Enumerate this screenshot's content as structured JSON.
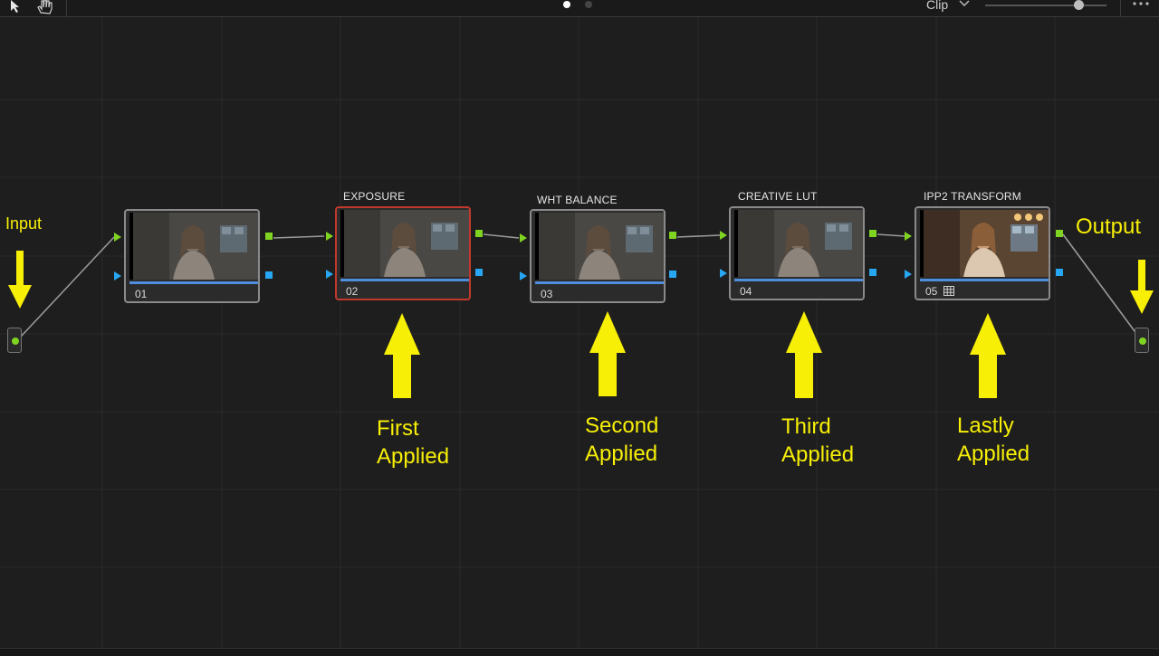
{
  "toolbar": {
    "pointer_icon": "pointer-arrow-icon",
    "hand_icon": "hand-pan-icon",
    "page_dots": 2,
    "active_page": 1,
    "mode_label": "Clip",
    "zoom_percent": 75,
    "more_icon": "ellipsis-icon"
  },
  "input_label": "Input",
  "output_label": "Output",
  "nodes": [
    {
      "number": "01",
      "title": ""
    },
    {
      "number": "02",
      "title": "EXPOSURE",
      "selected": true
    },
    {
      "number": "03",
      "title": "WHT BALANCE"
    },
    {
      "number": "04",
      "title": "CREATIVE LUT"
    },
    {
      "number": "05",
      "title": "IPP2 TRANSFORM",
      "badge_icon": "lut-grid-icon"
    }
  ],
  "annotations": [
    {
      "text": "First\nApplied"
    },
    {
      "text": "Second\nApplied"
    },
    {
      "text": "Third\nApplied"
    },
    {
      "text": "Lastly\nApplied"
    }
  ],
  "colors": {
    "annotation": "#f7ef05",
    "rgb_port": "#7fd321",
    "alpha_port": "#27a7f2",
    "selected_border": "#c0392b",
    "node_border": "#8a8a8c",
    "background": "#1e1e1f"
  }
}
